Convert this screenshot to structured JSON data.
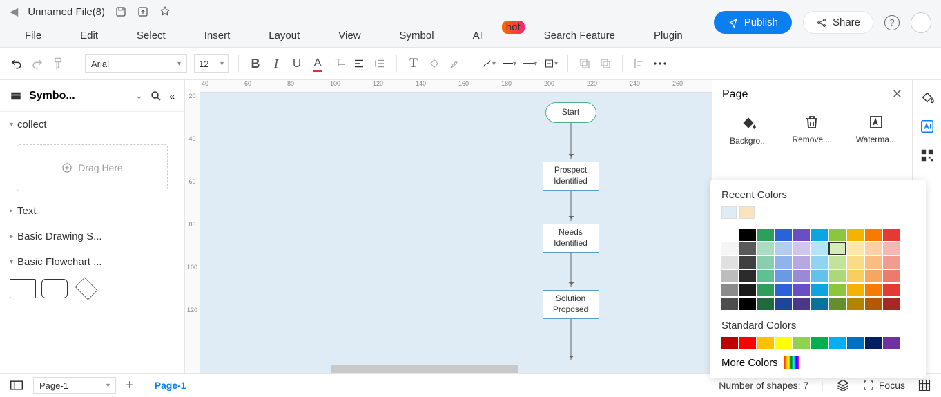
{
  "header": {
    "filename": "Unnamed File(8)",
    "publish": "Publish",
    "share": "Share"
  },
  "menu": {
    "file": "File",
    "edit": "Edit",
    "select": "Select",
    "insert": "Insert",
    "layout": "Layout",
    "view": "View",
    "symbol": "Symbol",
    "ai": "AI",
    "search": "Search Feature",
    "plugin": "Plugin",
    "hot": "hot"
  },
  "toolbar": {
    "font": "Arial",
    "size": "12"
  },
  "sidebar": {
    "title": "Symbo...",
    "sections": {
      "collect": "collect",
      "drag": "Drag Here",
      "text": "Text",
      "basic_drawing": "Basic Drawing S...",
      "basic_flowchart": "Basic Flowchart ..."
    }
  },
  "ruler_h": [
    "40",
    "60",
    "80",
    "100",
    "120",
    "140",
    "160",
    "180",
    "200",
    "220",
    "240",
    "260"
  ],
  "ruler_v": [
    "20",
    "40",
    "60",
    "80",
    "100",
    "120"
  ],
  "flow": {
    "start": "Start",
    "n1": "Prospect Identified",
    "n2": "Needs Identified",
    "n3": "Solution Proposed"
  },
  "page_panel": {
    "title": "Page",
    "bg": "Backgro...",
    "remove": "Remove ...",
    "watermark": "Waterma..."
  },
  "color_panel": {
    "recent_title": "Recent Colors",
    "recent": [
      "#dfecf5",
      "#fbe3c0"
    ],
    "grid": [
      [
        "#ffffff",
        "#000000",
        "#2e9e5b",
        "#2962d9",
        "#6a4fc4",
        "#0aa5e2",
        "#8cc63f",
        "#f5b301",
        "#f57c00",
        "#e53935"
      ],
      [
        "#f5f5f5",
        "#595959",
        "#a9dcc0",
        "#b3cdf2",
        "#cfc6ea",
        "#b3e4f7",
        "#d6ecb8",
        "#fce7a8",
        "#fbd0a5",
        "#f5b7b1"
      ],
      [
        "#e0e0e0",
        "#404040",
        "#8acfad",
        "#8fb4ea",
        "#b7a9e0",
        "#8fd4f0",
        "#c1e39a",
        "#fadc87",
        "#f9bd84",
        "#f19b91"
      ],
      [
        "#bdbdbd",
        "#2b2b2b",
        "#5fc092",
        "#6a9be2",
        "#9b89d6",
        "#63c2e8",
        "#a9d97a",
        "#f7cf61",
        "#f6a75f",
        "#ec7b6d"
      ],
      [
        "#8c8c8c",
        "#1a1a1a",
        "#2e9e5b",
        "#2962d9",
        "#6a4fc4",
        "#0aa5e2",
        "#8cc63f",
        "#f5b301",
        "#f57c00",
        "#e53935"
      ],
      [
        "#4d4d4d",
        "#000000",
        "#1f6b3d",
        "#1d4599",
        "#4a368a",
        "#07729e",
        "#638f2c",
        "#b38400",
        "#b35a00",
        "#a62824"
      ]
    ],
    "selected": [
      1,
      6
    ],
    "standard_title": "Standard Colors",
    "standard": [
      "#c00000",
      "#ff0000",
      "#ffc000",
      "#ffff00",
      "#92d050",
      "#00b050",
      "#00b0f0",
      "#0070c0",
      "#002060",
      "#7030a0"
    ],
    "more_title": "More Colors"
  },
  "footer": {
    "page_sel": "Page-1",
    "active_tab": "Page-1",
    "shapes": "Number of shapes: 7",
    "focus": "Focus"
  }
}
